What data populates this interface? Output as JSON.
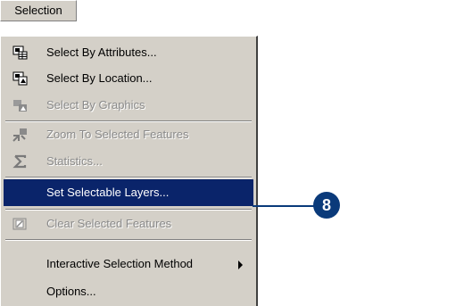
{
  "menubar": {
    "title": "Selection"
  },
  "menu": {
    "items": [
      {
        "label": "Select By Attributes...",
        "icon": "select-by-attributes-icon",
        "enabled": true
      },
      {
        "label": "Select By Location...",
        "icon": "select-by-location-icon",
        "enabled": true
      },
      {
        "label": "Select By Graphics",
        "icon": "select-by-graphics-icon",
        "enabled": false
      },
      {
        "label": "Zoom To Selected Features",
        "icon": "zoom-to-selected-icon",
        "enabled": false
      },
      {
        "label": "Statistics...",
        "icon": "sigma-icon",
        "enabled": false
      },
      {
        "label": "Set Selectable Layers...",
        "enabled": true,
        "selected": true
      },
      {
        "label": "Clear Selected Features",
        "icon": "clear-selection-icon",
        "enabled": false
      },
      {
        "label": "Interactive Selection Method",
        "enabled": true,
        "submenu": true
      },
      {
        "label": "Options...",
        "enabled": true
      }
    ]
  },
  "callout": {
    "number": "8"
  },
  "colors": {
    "highlight": "#0a246a",
    "menu_bg": "#d4d0c8",
    "callout": "#0a3a7a"
  }
}
